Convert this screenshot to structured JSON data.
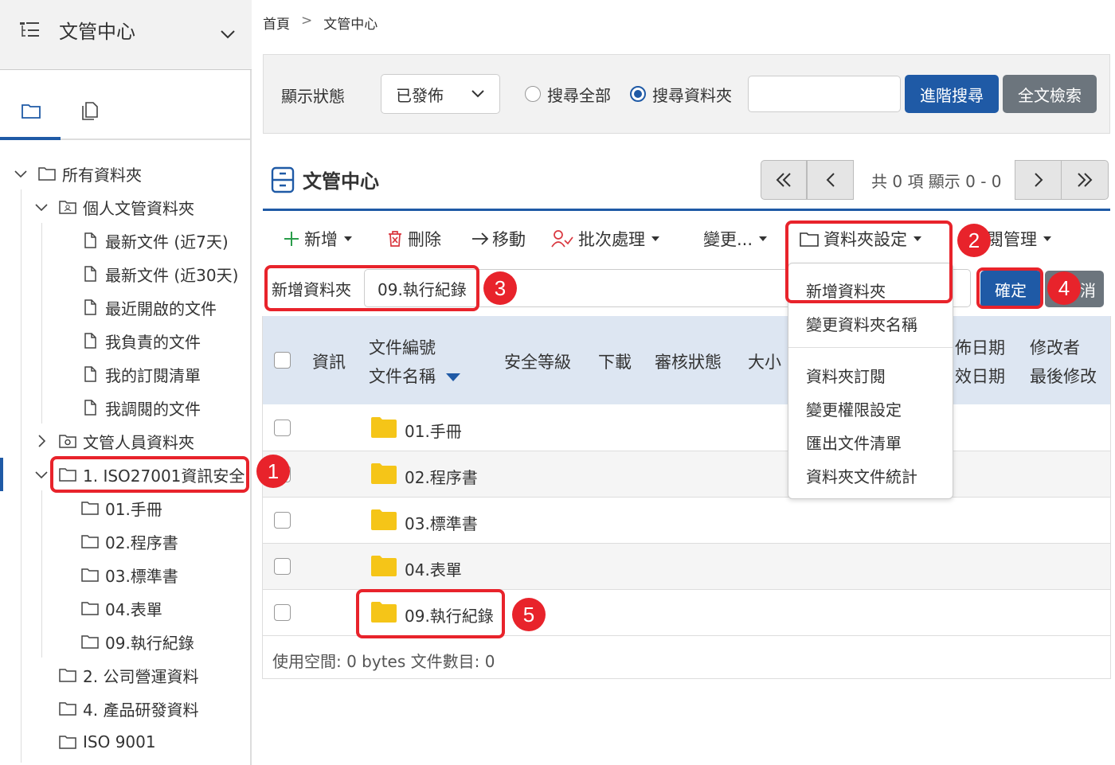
{
  "sidebar": {
    "title": "文管中心",
    "tree": {
      "all_folders": "所有資料夾",
      "personal": "個人文管資料夾",
      "recent7": "最新文件 (近7天)",
      "recent30": "最新文件 (近30天)",
      "recent_opened": "最近開啟的文件",
      "my_responsible": "我負責的文件",
      "my_subscriptions": "我的訂閱清單",
      "my_borrowed": "我調閱的文件",
      "staff": "文管人員資料夾",
      "iso27001": "1. ISO27001資訊安全",
      "sub1": "01.手冊",
      "sub2": "02.程序書",
      "sub3": "03.標準書",
      "sub4": "04.表單",
      "sub9": "09.執行紀錄",
      "company": "2. 公司營運資料",
      "rnd": "4. 產品研發資料",
      "iso9001": "ISO 9001"
    }
  },
  "breadcrumb": {
    "home": "首頁",
    "sep": ">",
    "current": "文管中心"
  },
  "search": {
    "status_label": "顯示狀態",
    "status_value": "已發佈",
    "radio_all": "搜尋全部",
    "radio_folder": "搜尋資料夾",
    "input_value": "",
    "advanced": "進階搜尋",
    "fulltext": "全文檢索"
  },
  "section_title": "文管中心",
  "pager": {
    "text": "共 0 項 顯示 0 - 0"
  },
  "toolbar": {
    "add": "新增",
    "delete": "刪除",
    "move": "移動",
    "batch": "批次處理",
    "change": "變更...",
    "folder_settings": "資料夾設定",
    "subscription": "訂閱管理"
  },
  "new_folder": {
    "label": "新增資料夾",
    "value": "09.執行紀錄",
    "confirm": "確定",
    "cancel": "消"
  },
  "dropdown": {
    "items": [
      "新增資料夾",
      "變更資料夾名稱",
      "資料夾訂閱",
      "變更權限設定",
      "匯出文件清單",
      "資料夾文件統計"
    ]
  },
  "table": {
    "headers": {
      "info": "資訊",
      "doc_no": "文件編號",
      "doc_name": "文件名稱",
      "security": "安全等級",
      "download": "下載",
      "review": "審核狀態",
      "size": "大小",
      "publish_date": "佈日期",
      "effective_date": "效日期",
      "modifier": "修改者",
      "last_modified": "最後修改"
    },
    "rows": [
      "01.手冊",
      "02.程序書",
      "03.標準書",
      "04.表單",
      "09.執行紀錄"
    ]
  },
  "footer": "使用空間: 0 bytes 文件數目: 0",
  "annotations": [
    "1",
    "2",
    "3",
    "4",
    "5"
  ],
  "colors": {
    "primary": "#1f5aa6",
    "annotation": "#e8232b",
    "folder": "#f5c518",
    "secondary_button": "#6c757d"
  }
}
